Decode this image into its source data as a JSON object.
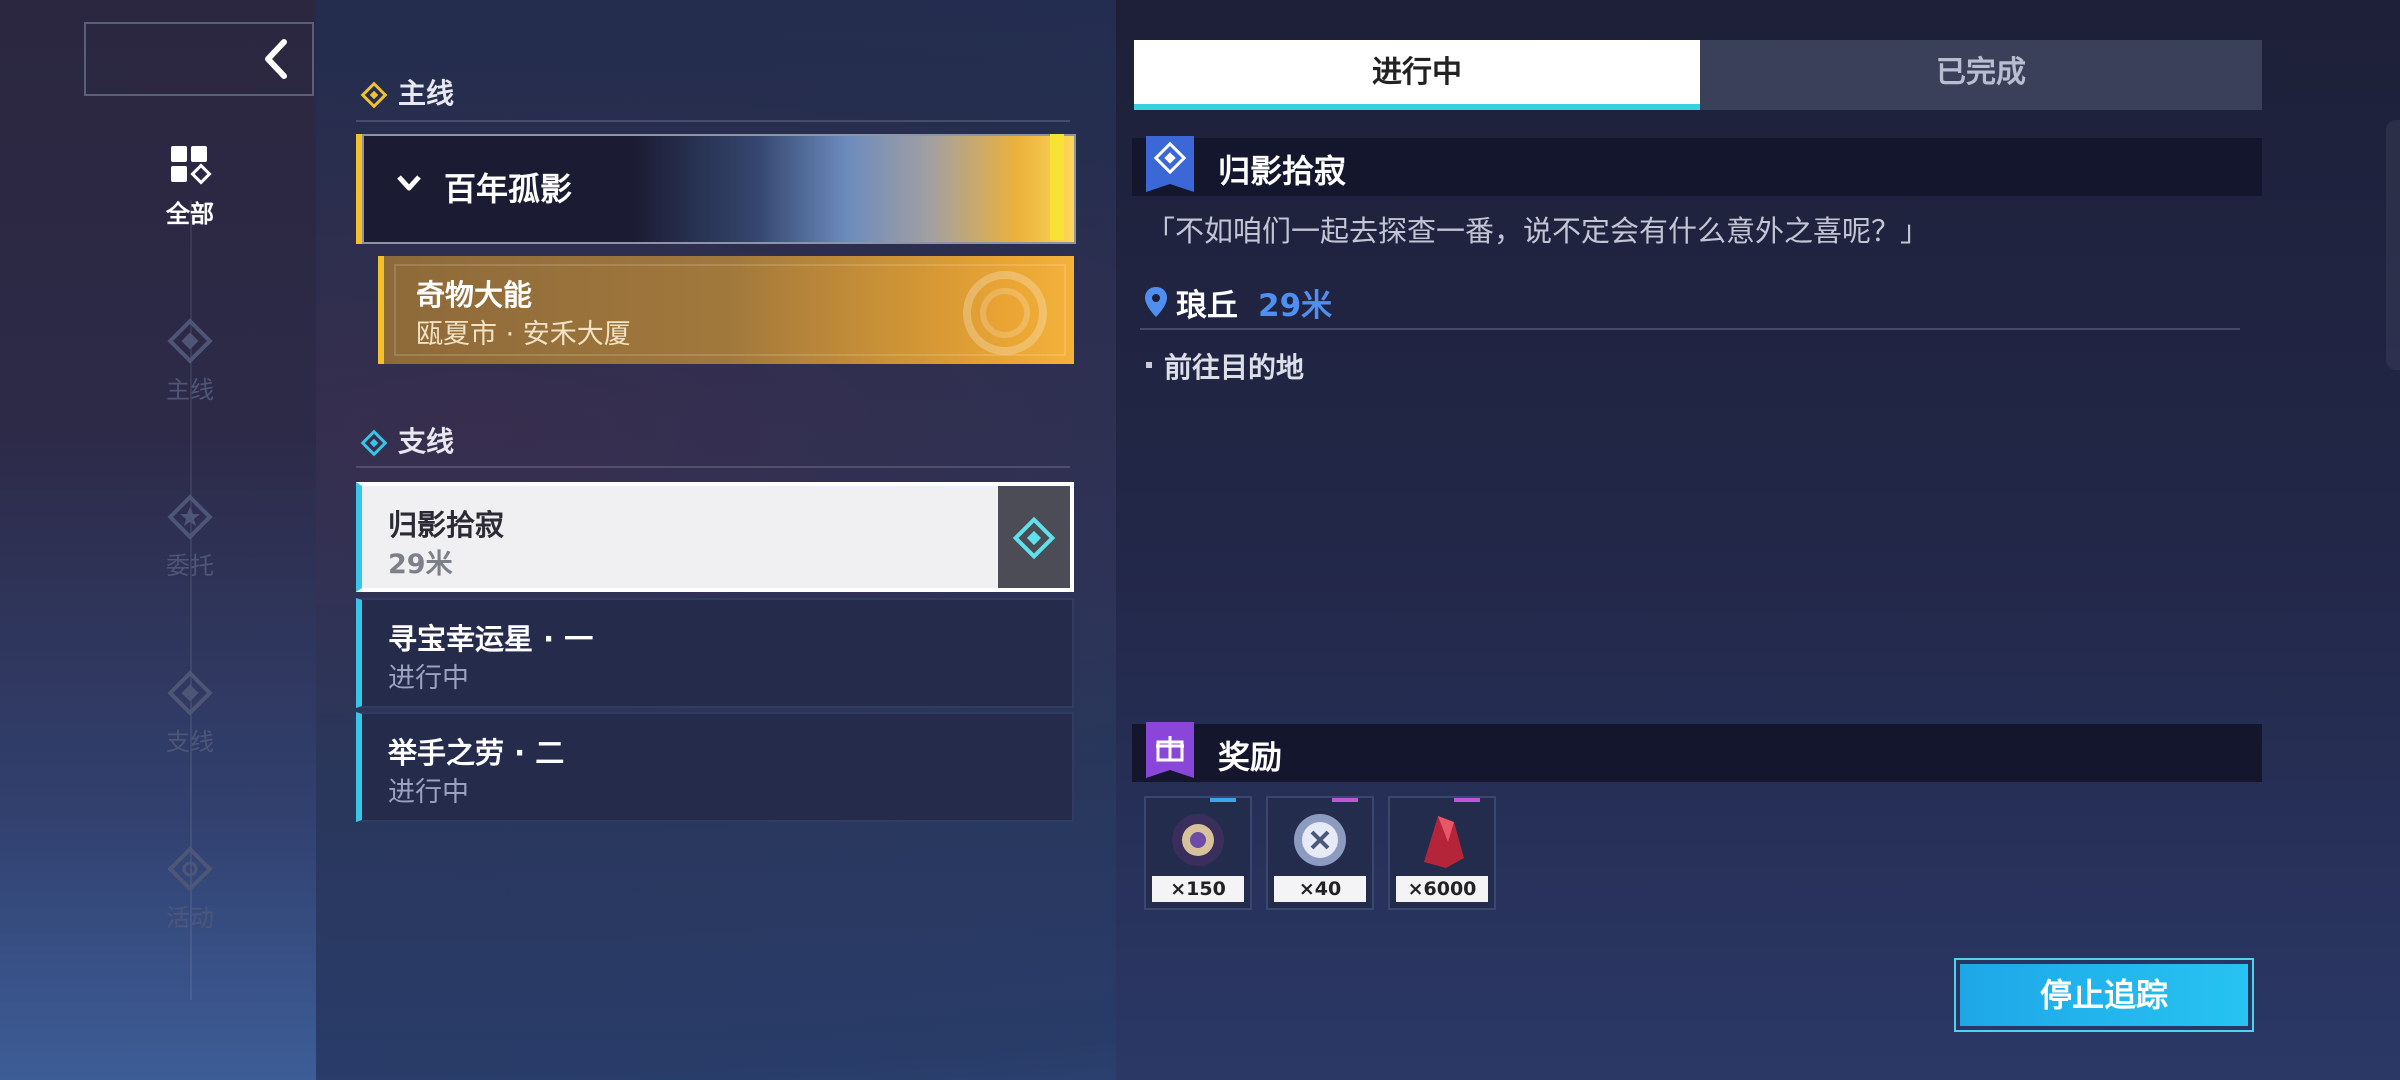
{
  "sidebar": {
    "categories": [
      {
        "label": "全部",
        "icon": "grid-icon",
        "active": true
      },
      {
        "label": "主线",
        "icon": "diamond-icon",
        "active": false
      },
      {
        "label": "委托",
        "icon": "star-badge-icon",
        "active": false
      },
      {
        "label": "支线",
        "icon": "diamond-icon",
        "active": false
      },
      {
        "label": "活动",
        "icon": "target-icon",
        "active": false
      }
    ]
  },
  "quest_list": {
    "main_section": "主线",
    "main_group": "百年孤影",
    "main_quest": {
      "title": "奇物大能",
      "location": "瓯夏市 · 安禾大厦"
    },
    "side_section": "支线",
    "side_quests": [
      {
        "title": "归影拾寂",
        "status": "29米"
      },
      {
        "title": "寻宝幸运星 · 一",
        "status": "进行中"
      },
      {
        "title": "举手之劳 · 二",
        "status": "进行中"
      }
    ]
  },
  "tabs": {
    "in_progress": "进行中",
    "completed": "已完成"
  },
  "detail": {
    "title": "归影拾寂",
    "quote": "「不如咱们一起去探查一番，说不定会有什么意外之喜呢？」",
    "location": "琅丘",
    "distance": "29米",
    "objective": "前往目的地",
    "rewards_title": "奖励",
    "rewards": [
      {
        "qty": "×150",
        "tag_color": "#3aa8e8"
      },
      {
        "qty": "×40",
        "tag_color": "#c056d8"
      },
      {
        "qty": "×6000",
        "tag_color": "#c056d8"
      }
    ],
    "stop_button": "停止追踪"
  },
  "colors": {
    "main_accent": "#f3c22b",
    "side_accent": "#38c6e8",
    "distance": "#4f8ff0",
    "reward_icon": "#8a46d8",
    "tab_underline": "#37d3dd"
  }
}
